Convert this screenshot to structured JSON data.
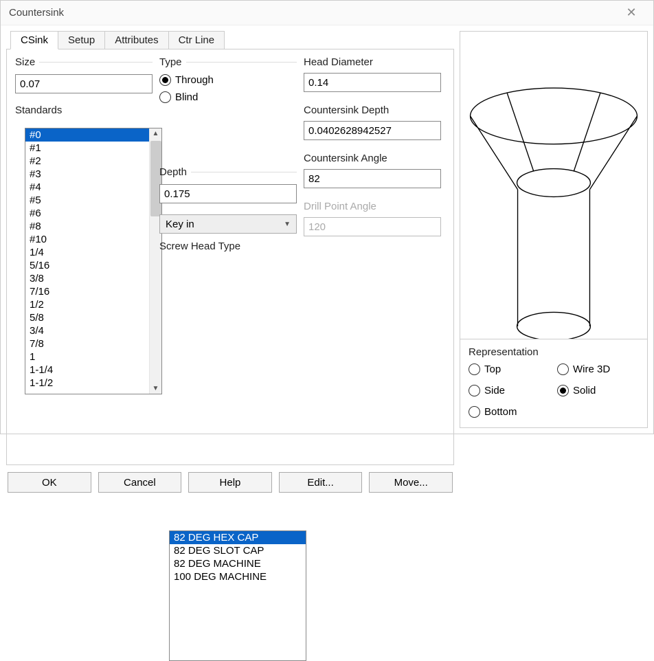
{
  "window": {
    "title": "Countersink"
  },
  "tabs": [
    "CSink",
    "Setup",
    "Attributes",
    "Ctr Line"
  ],
  "active_tab": 0,
  "size": {
    "label": "Size",
    "value": "0.07"
  },
  "standards": {
    "label": "Standards",
    "items": [
      "#0",
      "#1",
      "#2",
      "#3",
      "#4",
      "#5",
      "#6",
      "#8",
      "#10",
      "1/4",
      "5/16",
      "3/8",
      "7/16",
      "1/2",
      "5/8",
      "3/4",
      "7/8",
      "1",
      "1-1/4",
      "1-1/2"
    ],
    "selected_index": 0
  },
  "type": {
    "label": "Type",
    "through": "Through",
    "blind": "Blind",
    "value": "Through"
  },
  "depth": {
    "label": "Depth",
    "value": "0.175"
  },
  "key_in": {
    "label": "Key in"
  },
  "screw_head": {
    "label": "Screw Head Type",
    "items": [
      "82 DEG HEX CAP",
      "82 DEG SLOT CAP",
      "82 DEG MACHINE",
      "100 DEG MACHINE"
    ],
    "selected_index": 0
  },
  "head_diameter": {
    "label": "Head Diameter",
    "value": "0.14"
  },
  "cs_depth": {
    "label": "Countersink Depth",
    "value": "0.0402628942527"
  },
  "cs_angle": {
    "label": "Countersink Angle",
    "value": "82"
  },
  "drill_angle": {
    "label": "Drill Point Angle",
    "value": "120",
    "disabled": true
  },
  "buttons": {
    "ok": "OK",
    "cancel": "Cancel",
    "help": "Help",
    "edit": "Edit...",
    "move": "Move..."
  },
  "representation": {
    "label": "Representation",
    "options": [
      "Top",
      "Wire 3D",
      "Side",
      "Solid",
      "Bottom"
    ],
    "value": "Solid"
  }
}
